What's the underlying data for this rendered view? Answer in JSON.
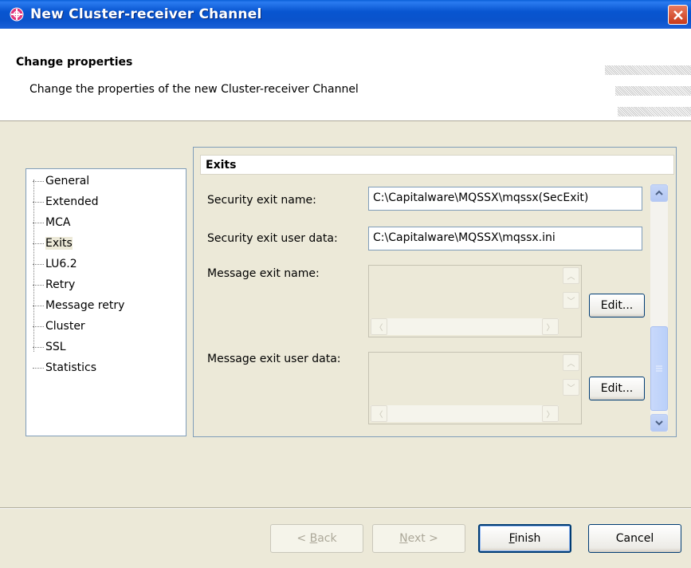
{
  "window": {
    "title": "New Cluster-receiver Channel",
    "close_glyph": "✕"
  },
  "header": {
    "title": "Change properties",
    "description": "Change the properties of the new Cluster-receiver Channel"
  },
  "nav": {
    "items": [
      {
        "label": "General"
      },
      {
        "label": "Extended"
      },
      {
        "label": "MCA"
      },
      {
        "label": "Exits",
        "selected": true
      },
      {
        "label": "LU6.2"
      },
      {
        "label": "Retry"
      },
      {
        "label": "Message retry"
      },
      {
        "label": "Cluster"
      },
      {
        "label": "SSL"
      },
      {
        "label": "Statistics"
      }
    ]
  },
  "panel": {
    "heading": "Exits",
    "security_exit_name": {
      "label": "Security exit name:",
      "value": "C:\\Capitalware\\MQSSX\\mqssx(SecExit)"
    },
    "security_exit_user_data": {
      "label": "Security exit user data:",
      "value": "C:\\Capitalware\\MQSSX\\mqssx.ini"
    },
    "message_exit_name": {
      "label": "Message exit name:",
      "edit_label": "Edit..."
    },
    "message_exit_user_data": {
      "label": "Message exit user data:",
      "edit_label": "Edit..."
    }
  },
  "footer": {
    "back": {
      "pre": "< ",
      "key": "B",
      "post": "ack"
    },
    "next": {
      "key": "N",
      "post": "ext >"
    },
    "finish": {
      "key": "F",
      "post": "inish"
    },
    "cancel": "Cancel"
  },
  "colors": {
    "titlebar": "#0855d0",
    "dialog_bg": "#ece9d8",
    "border": "#7f9db9"
  }
}
